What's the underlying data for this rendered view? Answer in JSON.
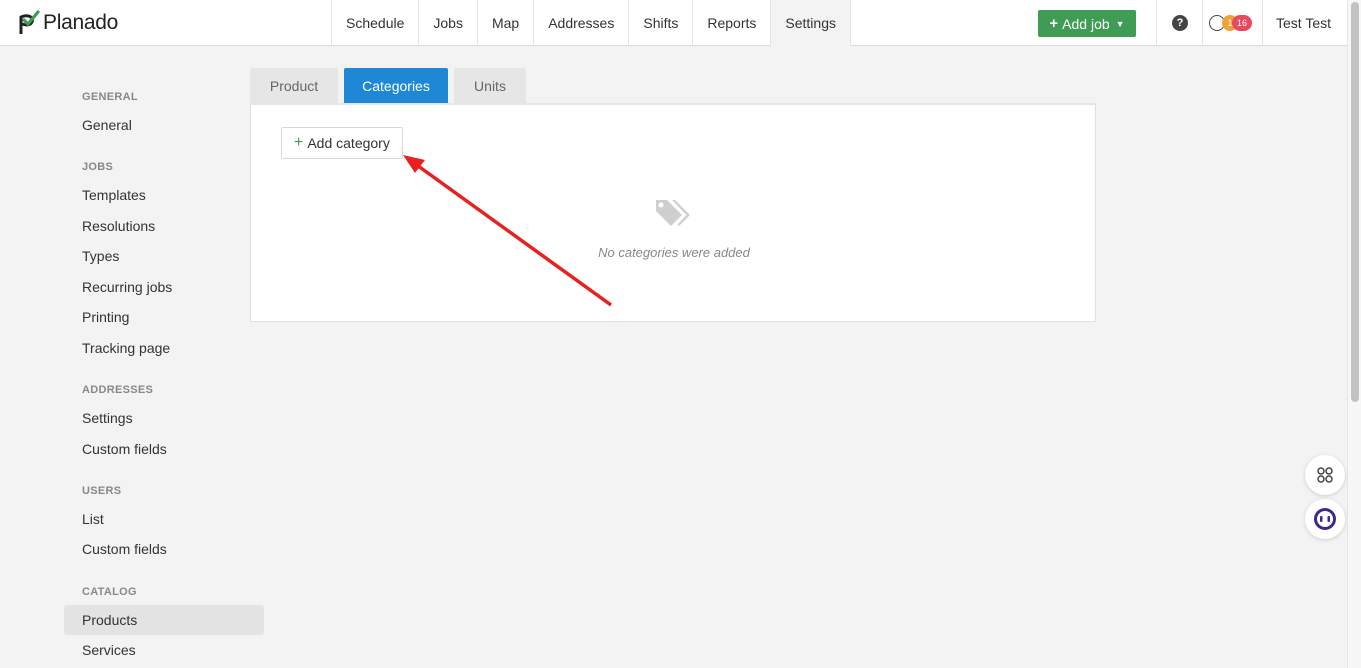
{
  "app": {
    "name": "Planado",
    "brand_color": "#3e9c55",
    "accent_color": "#1e88d6"
  },
  "nav": {
    "items": [
      "Schedule",
      "Jobs",
      "Map",
      "Addresses",
      "Shifts",
      "Reports",
      "Settings"
    ],
    "active": "Settings"
  },
  "header": {
    "add_job_label": "Add job",
    "help_glyph": "?",
    "notif_count_a": "1",
    "notif_count_b": "16",
    "user_name": "Test Test"
  },
  "sidebar": {
    "sections": {
      "general": "GENERAL",
      "jobs": "JOBS",
      "addresses": "ADDRESSES",
      "users": "USERS",
      "catalog": "CATALOG"
    },
    "items": {
      "general": "General",
      "templates": "Templates",
      "resolutions": "Resolutions",
      "types": "Types",
      "recurring_jobs": "Recurring jobs",
      "printing": "Printing",
      "tracking_page": "Tracking page",
      "addr_settings": "Settings",
      "addr_custom_fields": "Custom fields",
      "list": "List",
      "users_custom_fields": "Custom fields",
      "products": "Products",
      "services": "Services"
    },
    "active": "Products"
  },
  "tabs": {
    "product": "Product",
    "categories": "Categories",
    "units": "Units",
    "active": "Categories"
  },
  "panel": {
    "add_category_label": "Add category",
    "empty_text": "No categories were added",
    "empty_icon": "tags-icon"
  }
}
